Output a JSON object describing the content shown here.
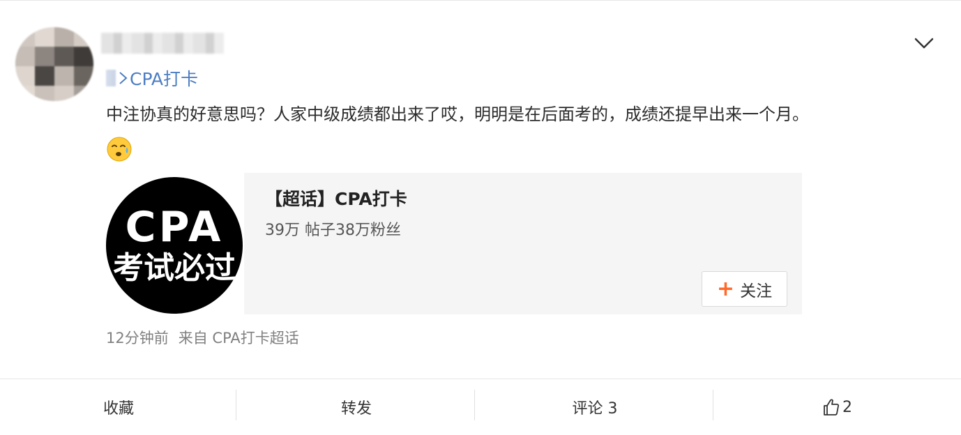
{
  "post": {
    "source": "CPA打卡",
    "text": "中注协真的好意思吗？人家中级成绩都出来了哎，明明是在后面考的，成绩还提早出来一个月。",
    "emoji": "sweat-face"
  },
  "topic_card": {
    "logo_line1": "CPA",
    "logo_line2": "考试必过",
    "title": "【超话】CPA打卡",
    "stats": "39万 帖子38万粉丝",
    "follow_label": "关注"
  },
  "meta": {
    "time": "12分钟前",
    "from": "来自 CPA打卡超话"
  },
  "actions": {
    "favorite": "收藏",
    "repost": "转发",
    "comment": "评论 3",
    "like_count": "2"
  },
  "colors": {
    "link": "#4c7ec3",
    "accent_plus": "#ff6a2b"
  }
}
